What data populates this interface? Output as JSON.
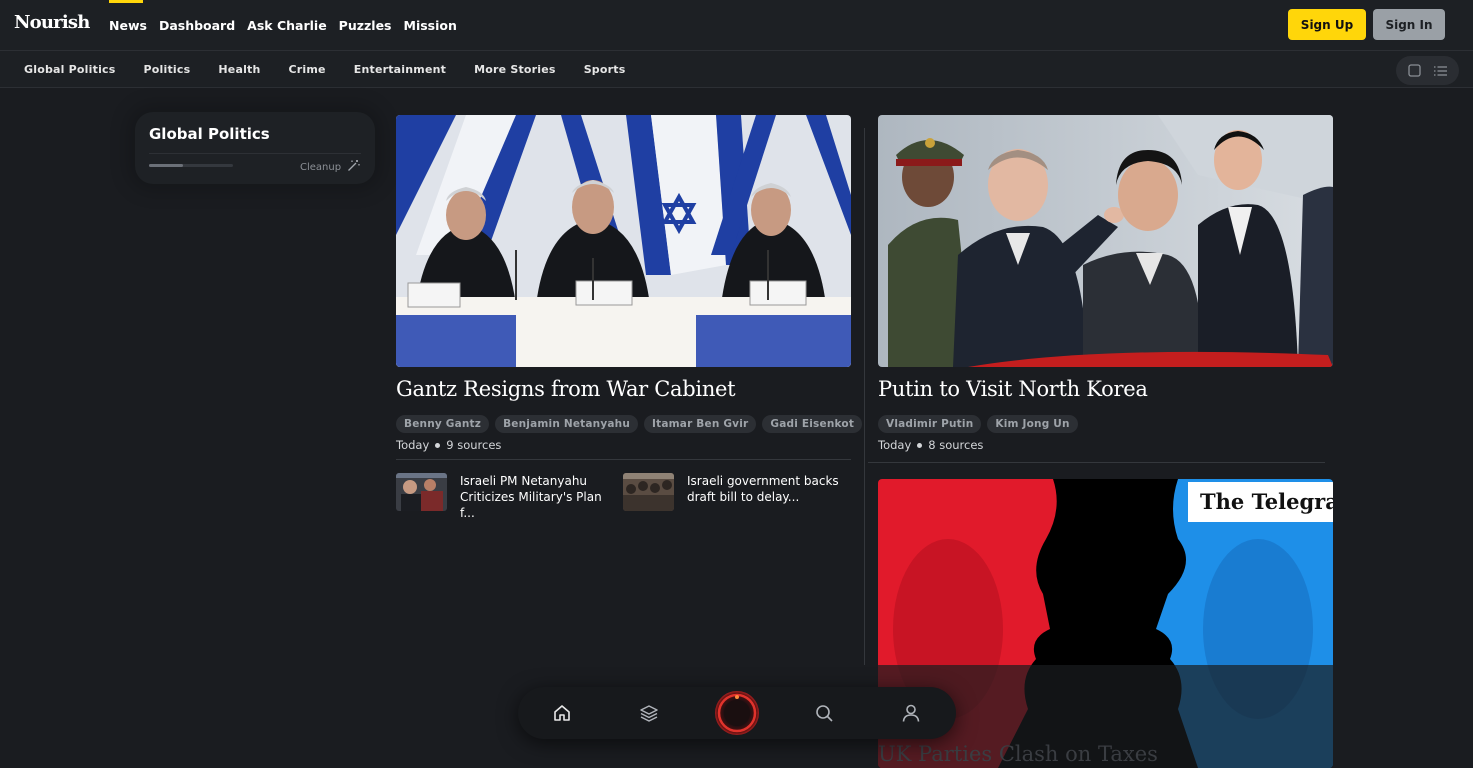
{
  "header": {
    "logo": "Nourish",
    "nav": [
      "News",
      "Dashboard",
      "Ask Charlie",
      "Puzzles",
      "Mission"
    ],
    "active_nav": "News",
    "signup_label": "Sign Up",
    "signin_label": "Sign In"
  },
  "categories": [
    "Global Politics",
    "Politics",
    "Health",
    "Crime",
    "Entertainment",
    "More Stories",
    "Sports"
  ],
  "side_panel": {
    "title": "Global Politics",
    "cleanup_label": "Cleanup",
    "progress": 0.4
  },
  "stories": [
    {
      "title": "Gantz Resigns from War Cabinet",
      "tags": [
        "Benny Gantz",
        "Benjamin Netanyahu",
        "Itamar Ben Gvir",
        "Gadi Eisenkot"
      ],
      "time": "Today",
      "sources": "9 sources",
      "related": [
        {
          "title": "Israeli PM Netanyahu Criticizes Military's Plan f..."
        },
        {
          "title": "Israeli government backs draft bill to delay..."
        }
      ]
    },
    {
      "title": "Putin to Visit North Korea",
      "tags": [
        "Vladimir Putin",
        "Kim Jong Un"
      ],
      "time": "Today",
      "sources": "8 sources"
    },
    {
      "title": "UK Parties Clash on Taxes",
      "image_text": "The Telegraph"
    }
  ],
  "colors": {
    "accent": "#ffd60a",
    "background": "#1a1c20",
    "panel": "#1e2125"
  },
  "dock": [
    "home-icon",
    "layers-icon",
    "charlie-orb",
    "search-icon",
    "user-icon"
  ]
}
